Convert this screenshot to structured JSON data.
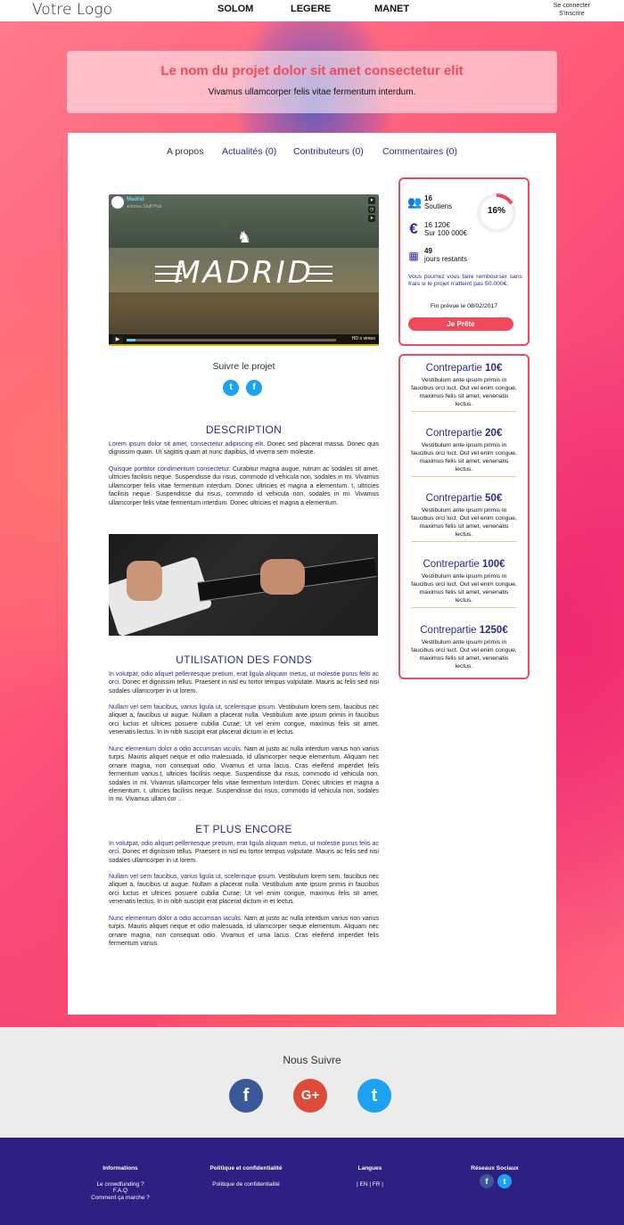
{
  "header": {
    "logo": "Votre Logo",
    "nav": [
      "SOLOM",
      "LEGERE",
      "MANET"
    ],
    "login": "Se connecter",
    "register": "S'inscrire"
  },
  "project": {
    "title": "Le nom du projet dolor sit amet consectetur elit",
    "subtitle": "Vivamus ullamcorper felis vitae fermentum interdum."
  },
  "tabs": [
    {
      "label": "A propos"
    },
    {
      "label": "Actualités (0)"
    },
    {
      "label": "Contributeurs (0)"
    },
    {
      "label": "Commentaires (0)"
    }
  ],
  "video": {
    "channel": "Madrid",
    "channel_sub": "●Vimeo Staff Pick",
    "title_overlay": "MADRID",
    "player_brand": "HD ≡ vimeo"
  },
  "follow": {
    "label": "Suivre le projet"
  },
  "description": {
    "title": "DESCRIPTION",
    "p1_lead": "Lorem ipsum dolor sit amet, consectetur adipiscing elit.",
    "p1_rest": " Donec sed placerat massa. Donec quis dignissim quam. Ut sagittis quam at nunc dapibus, id viverra sem molestie.",
    "p2_lead": "Quisque porttitor condimentum consectetur.",
    "p2_rest": " Curabitur magna augue, rutrum ac sodales sit amet, ultricies facilisis neque. Suspendisse dui risus, commodo id vehicula non, sodales in mi. Vivamus ullamcorper felis vitae fermentum interdum. Donec ultricies et magna a elementum. t, ultricies facilisis neque. Suspendisse dui risus, commodo id vehicula non, sodales in mi. Vivamus ullamcorper felis vitae fermentum interdum. Donec ultricies et magna a elementum."
  },
  "funds": {
    "title": "UTILISATION DES FONDS",
    "p1_lead": "In volutpat, odio aliquet pellentesque pretium, erat ligula aliquam metus, ut molestie purus felis ac orci.",
    "p1_rest": " Donec et dignissim tellus. Praesent in nisl eu tortor tempus vulputate. Mauris ac felis sed nisi sodales ullamcorper in ut lorem.",
    "p2_lead": "Nullam vel sem faucibus, varius ligula ut, scelerisque ipsum.",
    "p2_rest": " Vestibulum lorem sem, faucibus nec aliquet a, faucibus ut augue. Nullam a placerat nulla. Vestibulum ante ipsum primis in faucibus orci luctus et ultrices posuere cubilia Curae; Ut vel enim congue, maximus felis sit amet, venenatis lectus. In in nibh suscipit erat placerat dictum in et lectus.",
    "p3_lead": "Nunc elementum dolor a odio accumsan iaculis.",
    "p3_rest": " Nam at justo ac nulla interdum varius non varius turpis. Mauris aliquet neque et odio malesuada, id ullamcorper neque elementum. Aliquam nec ornare magna, non consequat odio. Vivamus et urna lacus. Cras eleifend imperdiet felis fermentum varius.t, ultricies facilisis neque. Suspendisse dui risus, commodo id vehicula non, sodales in mi. Vivamus ullamcorper felis vitae fermentum interdum. Donec ultricies et magna a elementum. t, ultricies facilisis neque. Suspendisse dui risus, commodo id vehicula non, sodales in mi. Vivamus ullam cor .."
  },
  "more": {
    "title": "ET PLUS ENCORE",
    "p1_lead": "In volutpat, odio aliquet pellentesque pretium, erat ligula aliquam metus, ut molestie purus felis ac orci.",
    "p1_rest": " Donec et dignissim tellus. Praesent in nisl eu tortor tempus vulputate. Mauris ac felis sed nisi sodales ullamcorper in ut lorem.",
    "p2_lead": "Nullam vel sem faucibus, varius ligula ut, scelerisque ipsum.",
    "p2_rest": " Vestibulum lorem sem, faucibus nec aliquet a, faucibus ut augue. Nullam a placerat nulla. Vestibulum ante ipsum primis in faucibus orci luctus et ultrices posuere cubilia Curae; Ut vel enim congue, maximus felis sit amet, venenatis lectus. In in nibh suscipit erat placerat dictum in et lectus.",
    "p3_lead": "Nunc elementum dolor a odio accumsan iaculis.",
    "p3_rest": " Nam at justo ac nulla interdum varius non varius turpis. Mauris aliquet neque et odio malesuada, id ullamcorper neque elementum. Aliquam nec ornare magna, non consequat odio. Vivamus et urna lacus. Cras eleifend imperdiet felis fermentum varius."
  },
  "stats": {
    "backers_count": "16",
    "backers_label": "Soutiens",
    "amount": "16 120€",
    "goal": "Sur 100 000€",
    "days_count": "49",
    "days_label": "jours restants",
    "progress_label": "16%",
    "progress_fraction": 0.16,
    "refund_note": "Vous pourrez vous faire rembourser sans frais si le projet n'atteint pas 50.000€.",
    "end_date": "Fin prévue le 08/02/2017",
    "cta": "Je Prête"
  },
  "rewards": [
    {
      "label": "Contrepartie",
      "amount": "10€",
      "desc": "Vestibulum ante ipsum primis in faucibus orci luct. Out vel enim congue, maximus felis sit amet, venenatis lectus."
    },
    {
      "label": "Contrepartie",
      "amount": "20€",
      "desc": "Vestibulum ante ipsum primis in faucibus orci luct. Out vel enim congue, maximus felis sit amet, venenatis lectus."
    },
    {
      "label": "Contrepartie",
      "amount": "50€",
      "desc": "Vestibulum ante ipsum primis in faucibus orci luct. Out vel enim congue, maximus felis sit amet, venenatis lectus."
    },
    {
      "label": "Contrepartie",
      "amount": "100€",
      "desc": "Vestibulum ante ipsum primis in faucibus orci luct. Out vel enim congue, maximus felis sit amet, venenatis lectus."
    },
    {
      "label": "Contrepartie",
      "amount": "1250€",
      "desc": "Vestibulum ante ipsum primis in faucibus orci luct. Out vel enim congue, maximus felis sit amet, venenatis lectus."
    }
  ],
  "social_band": {
    "title": "Nous Suivre"
  },
  "footer": {
    "informations": {
      "title": "Informations",
      "links": [
        "Le crowdfunding ?",
        "F.A.Q",
        "Comment ça marche ?"
      ]
    },
    "policy": {
      "title": "Politique et confidentialité",
      "links": [
        "Politique de confidentialité"
      ]
    },
    "languages": {
      "title": "Langues",
      "value": "| EN | FR |"
    },
    "social": {
      "title": "Réseaux Sociaux"
    }
  },
  "colors": {
    "accent": "#f04a5c",
    "primary": "#2c2a8c",
    "footer_bg": "#2e1f82",
    "facebook": "#3b5998",
    "twitter": "#1da1f2",
    "gplus": "#dd4b39"
  }
}
